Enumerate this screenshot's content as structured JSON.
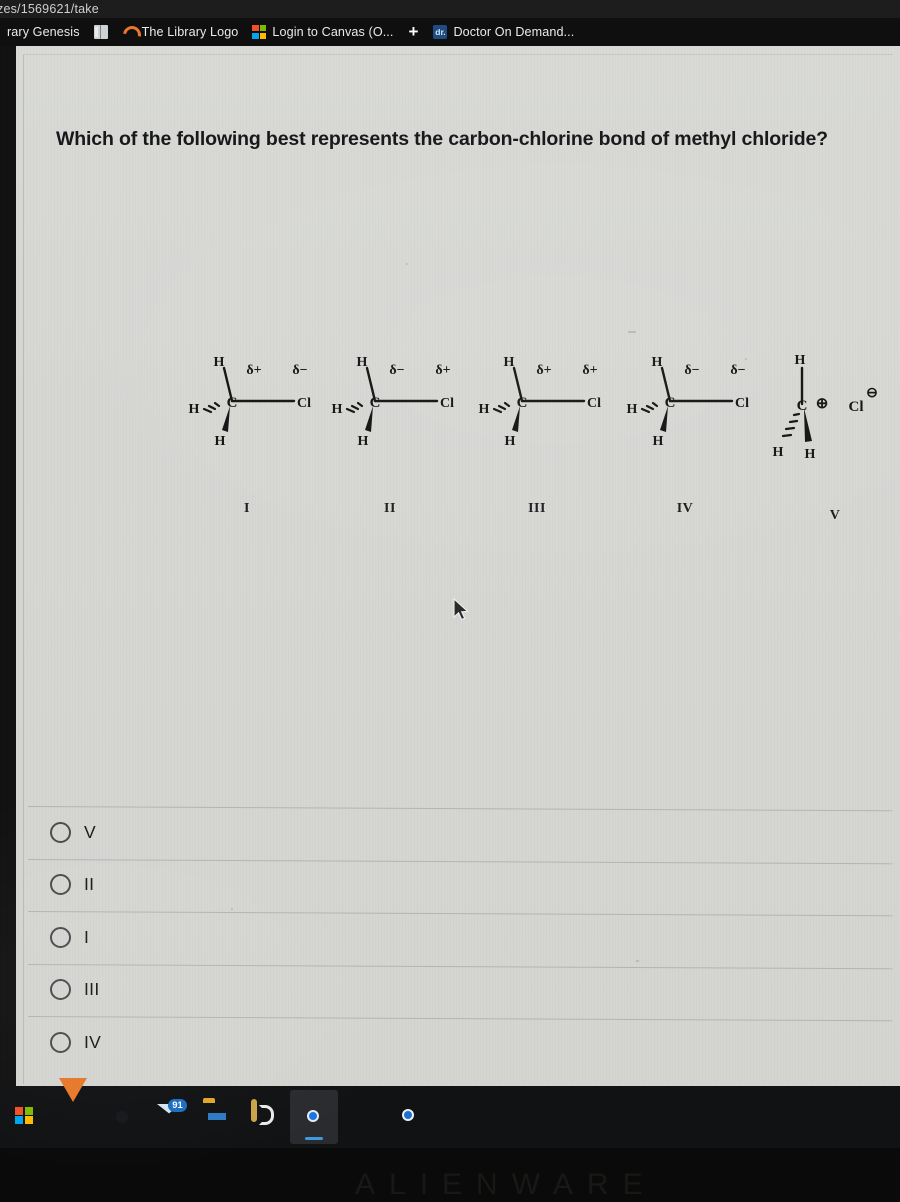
{
  "browser": {
    "url_fragment": "zes/1569621/take",
    "bookmarks": [
      {
        "label": "rary Genesis",
        "icon": "globe-icon"
      },
      {
        "label": "",
        "icon": "book-icon"
      },
      {
        "label": "The Library Logo",
        "icon": "library-arc-icon"
      },
      {
        "label": "Login to Canvas (O...",
        "icon": "microsoft-icon"
      },
      {
        "label": "+",
        "icon": "plus-icon"
      },
      {
        "label": "Doctor On Demand...",
        "icon": "doctor-on-demand-icon",
        "icon_text": "dr."
      }
    ]
  },
  "quiz": {
    "question": "Which of the following best represents the carbon-chlorine bond of methyl chloride?",
    "structures": [
      {
        "label": "I",
        "type": "tetrahedral-ch3cl",
        "carbon_symbol": "C",
        "halogen_symbol": "Cl",
        "carbon_charge": "δ+",
        "halogen_charge": "δ−",
        "hydrogens": [
          "H",
          "H",
          "H"
        ]
      },
      {
        "label": "II",
        "type": "tetrahedral-ch3cl",
        "carbon_symbol": "C",
        "halogen_symbol": "Cl",
        "carbon_charge": "δ−",
        "halogen_charge": "δ+",
        "hydrogens": [
          "H",
          "H",
          "H"
        ]
      },
      {
        "label": "III",
        "type": "tetrahedral-ch3cl",
        "carbon_symbol": "C",
        "halogen_symbol": "Cl",
        "carbon_charge": "δ+",
        "halogen_charge": "δ+",
        "hydrogens": [
          "H",
          "H",
          "H"
        ]
      },
      {
        "label": "IV",
        "type": "tetrahedral-ch3cl",
        "carbon_symbol": "C",
        "halogen_symbol": "Cl",
        "carbon_charge": "δ−",
        "halogen_charge": "δ−",
        "hydrogens": [
          "H",
          "H",
          "H"
        ]
      },
      {
        "label": "V",
        "type": "ion-pair",
        "carbon_symbol": "C",
        "halogen_symbol": "Cl",
        "carbon_charge": "⊕",
        "halogen_charge": "⊖",
        "hydrogens": [
          "H",
          "H",
          "H"
        ]
      }
    ],
    "options": [
      {
        "label": "V",
        "selected": false
      },
      {
        "label": "II",
        "selected": false
      },
      {
        "label": "I",
        "selected": false
      },
      {
        "label": "III",
        "selected": false
      },
      {
        "label": "IV",
        "selected": false
      }
    ]
  },
  "taskbar": {
    "items": [
      {
        "name": "microsoft-store-icon",
        "badge": ""
      },
      {
        "name": "vlc-media-player-icon",
        "badge": ""
      },
      {
        "name": "office-icon",
        "badge": ""
      },
      {
        "name": "mail-icon",
        "badge": "91"
      },
      {
        "name": "file-explorer-icon",
        "badge": ""
      },
      {
        "name": "lenovo-vantage-icon",
        "badge": ""
      },
      {
        "name": "google-chrome-icon",
        "badge": "",
        "running": true
      },
      {
        "name": "microsoft-edge-icon",
        "badge": ""
      },
      {
        "name": "settings-gear-icon",
        "badge": ""
      }
    ]
  },
  "device": {
    "brand": "ALIENWARE"
  },
  "colors": {
    "page_background": "#d6d7d3",
    "chrome_dark": "#0f0f0f",
    "text": "#16181a",
    "taskbar": "#111214"
  }
}
